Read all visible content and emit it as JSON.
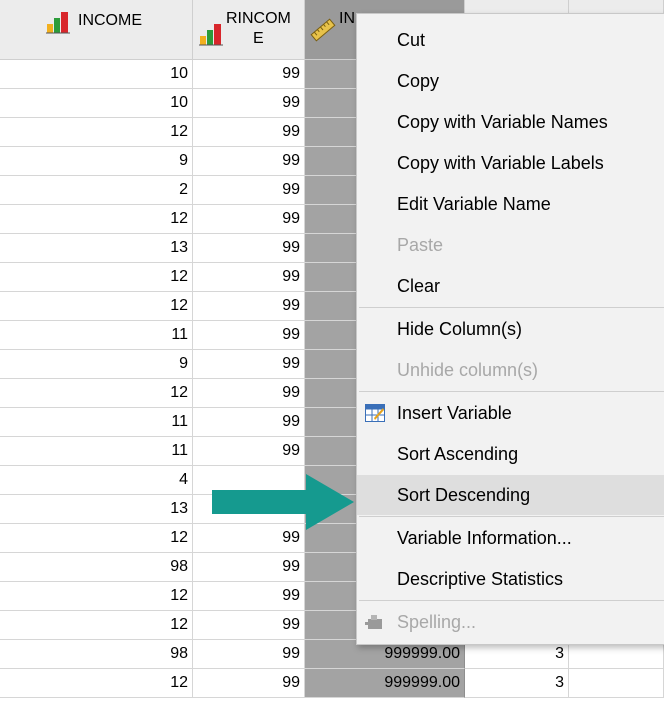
{
  "headers": {
    "income": "INCOME",
    "rincome_line1": "RINCOM",
    "rincome_line2": "E",
    "third_partial": "IN"
  },
  "rows": [
    {
      "income": "10",
      "rincome": "99",
      "third": ""
    },
    {
      "income": "10",
      "rincome": "99",
      "third": ""
    },
    {
      "income": "12",
      "rincome": "99",
      "third": ""
    },
    {
      "income": "9",
      "rincome": "99",
      "third": ""
    },
    {
      "income": "2",
      "rincome": "99",
      "third": ""
    },
    {
      "income": "12",
      "rincome": "99",
      "third": ""
    },
    {
      "income": "13",
      "rincome": "99",
      "third": ""
    },
    {
      "income": "12",
      "rincome": "99",
      "third": ""
    },
    {
      "income": "12",
      "rincome": "99",
      "third": ""
    },
    {
      "income": "11",
      "rincome": "99",
      "third": ""
    },
    {
      "income": "9",
      "rincome": "99",
      "third": ""
    },
    {
      "income": "12",
      "rincome": "99",
      "third": ""
    },
    {
      "income": "11",
      "rincome": "99",
      "third": ""
    },
    {
      "income": "11",
      "rincome": "99",
      "third": ""
    },
    {
      "income": "4",
      "rincome": "",
      "third": ""
    },
    {
      "income": "13",
      "rincome": "99",
      "third": ""
    },
    {
      "income": "12",
      "rincome": "99",
      "third": ""
    },
    {
      "income": "98",
      "rincome": "99",
      "third": ""
    },
    {
      "income": "12",
      "rincome": "99",
      "third": ""
    },
    {
      "income": "12",
      "rincome": "99",
      "third": "999999.00",
      "c4": "3"
    },
    {
      "income": "98",
      "rincome": "99",
      "third": "999999.00",
      "c4": "3"
    },
    {
      "income": "12",
      "rincome": "99",
      "third": "999999.00",
      "c4": "3"
    }
  ],
  "context_menu": {
    "cut": "Cut",
    "copy": "Copy",
    "copy_names": "Copy with Variable Names",
    "copy_labels": "Copy with Variable Labels",
    "edit_name": "Edit Variable Name",
    "paste": "Paste",
    "clear": "Clear",
    "hide": "Hide Column(s)",
    "unhide": "Unhide column(s)",
    "insert_var": "Insert Variable",
    "sort_asc": "Sort Ascending",
    "sort_desc": "Sort Descending",
    "var_info": "Variable Information...",
    "desc_stats": "Descriptive Statistics",
    "spelling": "Spelling..."
  },
  "colors": {
    "arrow": "#159a8f",
    "selected_column": "#a3a3a3",
    "menu_bg": "#f2f2f2",
    "highlight": "#dedede"
  },
  "icons": {
    "income": "nominal-bar-chart-icon",
    "rincome": "nominal-bar-chart-icon",
    "third": "scale-ruler-icon",
    "insert_var": "insert-variable-icon",
    "spelling": "spelling-icon"
  }
}
